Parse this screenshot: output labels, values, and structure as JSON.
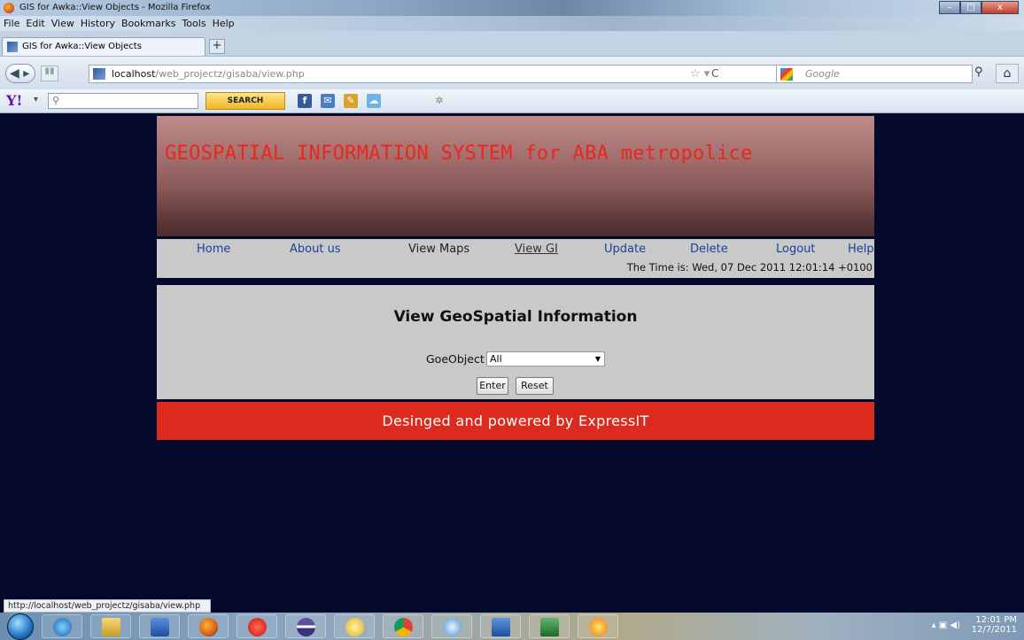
{
  "window": {
    "title": "GIS for Awka::View Objects - Mozilla Firefox",
    "controls": {
      "minimize": "–",
      "maximize": "□",
      "close": "x"
    }
  },
  "menu": [
    "File",
    "Edit",
    "View",
    "History",
    "Bookmarks",
    "Tools",
    "Help"
  ],
  "tab": {
    "title": "GIS for Awka::View Objects",
    "new_tab": "+"
  },
  "address_bar": {
    "host": "localhost",
    "path": "/web_projectz/gisaba/view.php"
  },
  "search_bar": {
    "placeholder": "Google"
  },
  "yahoo_toolbar": {
    "logo": "Y!",
    "search_button": "SEARCH"
  },
  "page": {
    "banner_title": "GEOSPATIAL INFORMATION SYSTEM for ABA metropolice",
    "nav": [
      "Home",
      "About us",
      "View Maps",
      "View GI",
      "Update",
      "Delete",
      "Logout",
      "Help"
    ],
    "time_text": "The Time is: Wed, 07 Dec 2011 12:01:14 +0100",
    "heading": "View GeoSpatial Information",
    "filter_label": "GoeObject",
    "filter_value": "All",
    "enter_button": "Enter",
    "reset_button": "Reset",
    "footer": "Desinged and powered by ExpressIT"
  },
  "status_bar": {
    "url": "http://localhost/web_projectz/gisaba/view.php"
  },
  "taskbar": {
    "time": "12:01 PM",
    "date": "12/7/2011"
  },
  "colors": {
    "page_bg": "#03092a",
    "banner_title": "#e8281c",
    "footer_bg": "#dc2a1f",
    "nav_link": "#1d3f9c"
  }
}
